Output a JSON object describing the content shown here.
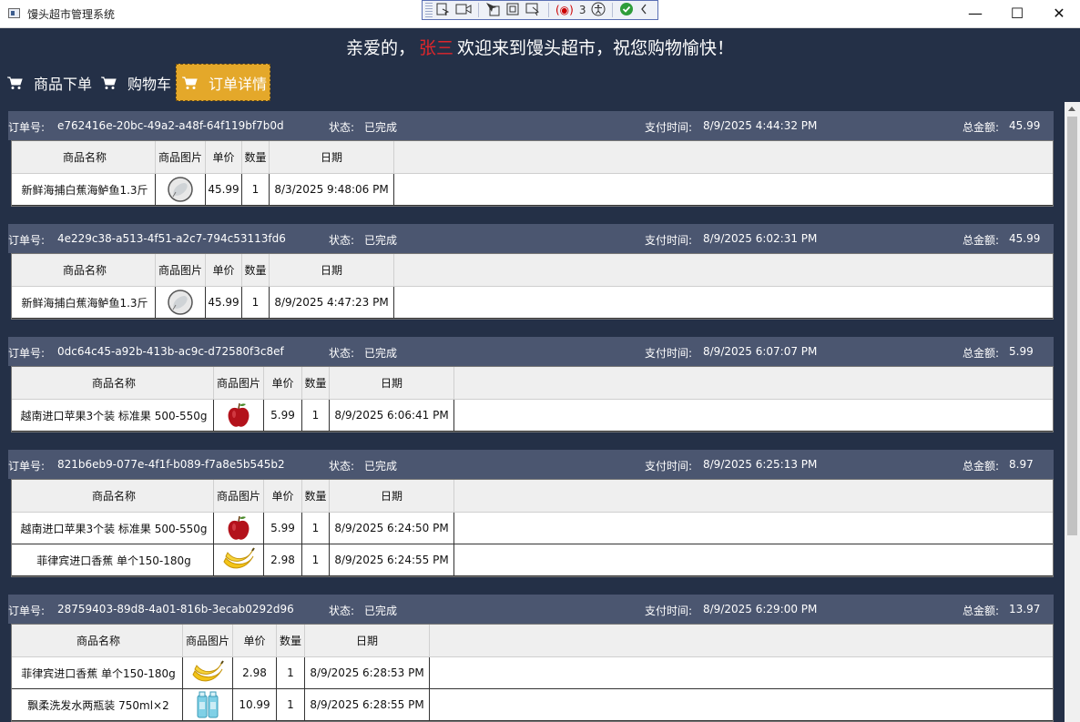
{
  "window": {
    "title": "馒头超市管理系统",
    "controls": {
      "minimize": "—",
      "maximize": "☐",
      "close": "✕"
    }
  },
  "debug_toolbar": {
    "count": "3",
    "icons": [
      "select-element-icon",
      "record-icon",
      "pointer-icon",
      "layout-icon",
      "track-focus-icon",
      "binding-failures-icon",
      "accessibility-icon",
      "check-icon",
      "collapse-icon"
    ]
  },
  "greeting": {
    "before": "亲爱的，",
    "name": "张三",
    "after": "欢迎来到馒头超市，祝您购物愉快！"
  },
  "colors": {
    "background": "#243047",
    "order_header": "#4b5670",
    "accent": "#e4a82a",
    "name": "#e0262b"
  },
  "nav": [
    {
      "label": "商品下单",
      "icon": "cart-icon",
      "active": false
    },
    {
      "label": "购物车",
      "icon": "cart-icon",
      "active": false
    },
    {
      "label": "订单详情",
      "icon": "cart-icon",
      "active": true
    }
  ],
  "labels": {
    "order_id": "订单号:",
    "status": "状态:",
    "paid_time": "支付时间:",
    "total": "总金额:"
  },
  "columns": [
    "商品名称",
    "商品图片",
    "单价",
    "数量",
    "日期"
  ],
  "orders": [
    {
      "id": "e762416e-20bc-49a2-a48f-64f119bf7b0d",
      "status": "已完成",
      "paid_time": "8/9/2025 4:44:32 PM",
      "total": "45.99",
      "items": [
        {
          "name": "新鲜海捕白蕉海鲈鱼1.3斤",
          "image": "fish-image",
          "price": "45.99",
          "qty": "1",
          "date": "8/3/2025 9:48:06 PM"
        }
      ]
    },
    {
      "id": "4e229c38-a513-4f51-a2c7-794c53113fd6",
      "status": "已完成",
      "paid_time": "8/9/2025 6:02:31 PM",
      "total": "45.99",
      "items": [
        {
          "name": "新鲜海捕白蕉海鲈鱼1.3斤",
          "image": "fish-image",
          "price": "45.99",
          "qty": "1",
          "date": "8/9/2025 4:47:23 PM"
        }
      ]
    },
    {
      "id": "0dc64c45-a92b-413b-ac9c-d72580f3c8ef",
      "status": "已完成",
      "paid_time": "8/9/2025 6:07:07 PM",
      "total": "5.99",
      "items": [
        {
          "name": "越南进口苹果3个装 标准果 500-550g",
          "image": "apple-image",
          "price": "5.99",
          "qty": "1",
          "date": "8/9/2025 6:06:41 PM"
        }
      ]
    },
    {
      "id": "821b6eb9-077e-4f1f-b089-f7a8e5b545b2",
      "status": "已完成",
      "paid_time": "8/9/2025 6:25:13 PM",
      "total": "8.97",
      "items": [
        {
          "name": "越南进口苹果3个装 标准果 500-550g",
          "image": "apple-image",
          "price": "5.99",
          "qty": "1",
          "date": "8/9/2025 6:24:50 PM"
        },
        {
          "name": "菲律宾进口香蕉 单个150-180g",
          "image": "banana-image",
          "price": "2.98",
          "qty": "1",
          "date": "8/9/2025 6:24:55 PM"
        }
      ]
    },
    {
      "id": "28759403-89d8-4a01-816b-3ecab0292d96",
      "status": "已完成",
      "paid_time": "8/9/2025 6:29:00 PM",
      "total": "13.97",
      "items": [
        {
          "name": "菲律宾进口香蕉 单个150-180g",
          "image": "banana-image",
          "price": "2.98",
          "qty": "1",
          "date": "8/9/2025 6:28:53 PM"
        },
        {
          "name": "飘柔洗发水两瓶装 750ml×2",
          "image": "shampoo-image",
          "price": "10.99",
          "qty": "1",
          "date": "8/9/2025 6:28:55 PM"
        }
      ]
    }
  ]
}
